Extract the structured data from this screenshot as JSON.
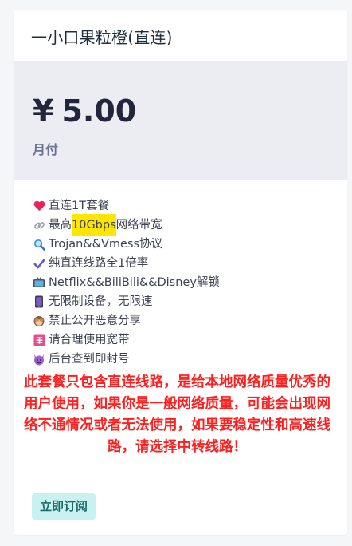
{
  "plan": {
    "title": "一小口果粒橙(直连)",
    "currency": "¥",
    "price": "5.00",
    "period": "月付",
    "features": [
      {
        "icon": "heart-icon",
        "text": "直连1T套餐"
      },
      {
        "icon": "link-icon",
        "text_pre": "最高",
        "text_highlight": "10Gbps",
        "text_post": "网络带宽"
      },
      {
        "icon": "magnifier-icon",
        "text": "Trojan&&Vmess协议"
      },
      {
        "icon": "checkmark-icon",
        "text": "纯直连线路全1倍率"
      },
      {
        "icon": "tv-icon",
        "text": "Netflix&&BiliBili&&Disney解锁"
      },
      {
        "icon": "phone-icon",
        "text": "无限制设备，无限速"
      },
      {
        "icon": "monkey-icon",
        "text": "禁止公开恶意分享"
      },
      {
        "icon": "rent-icon",
        "text": "请合理使用宽带"
      },
      {
        "icon": "devil-icon",
        "text": "后台查到即封号"
      }
    ],
    "warning": "此套餐只包含直连线路，是给本地网络质量优秀的用户使用，如果你是一般网络质量，可能会出现网络不通情况或者无法使用，如果要稳定性和高速线路，请选择中转线路！",
    "subscribe_label": "立即订阅",
    "colors": {
      "warning": "#ff1f1f",
      "highlight": "#ffe600",
      "button_bg": "#c9f1ef",
      "button_text": "#1a6b6a"
    }
  }
}
